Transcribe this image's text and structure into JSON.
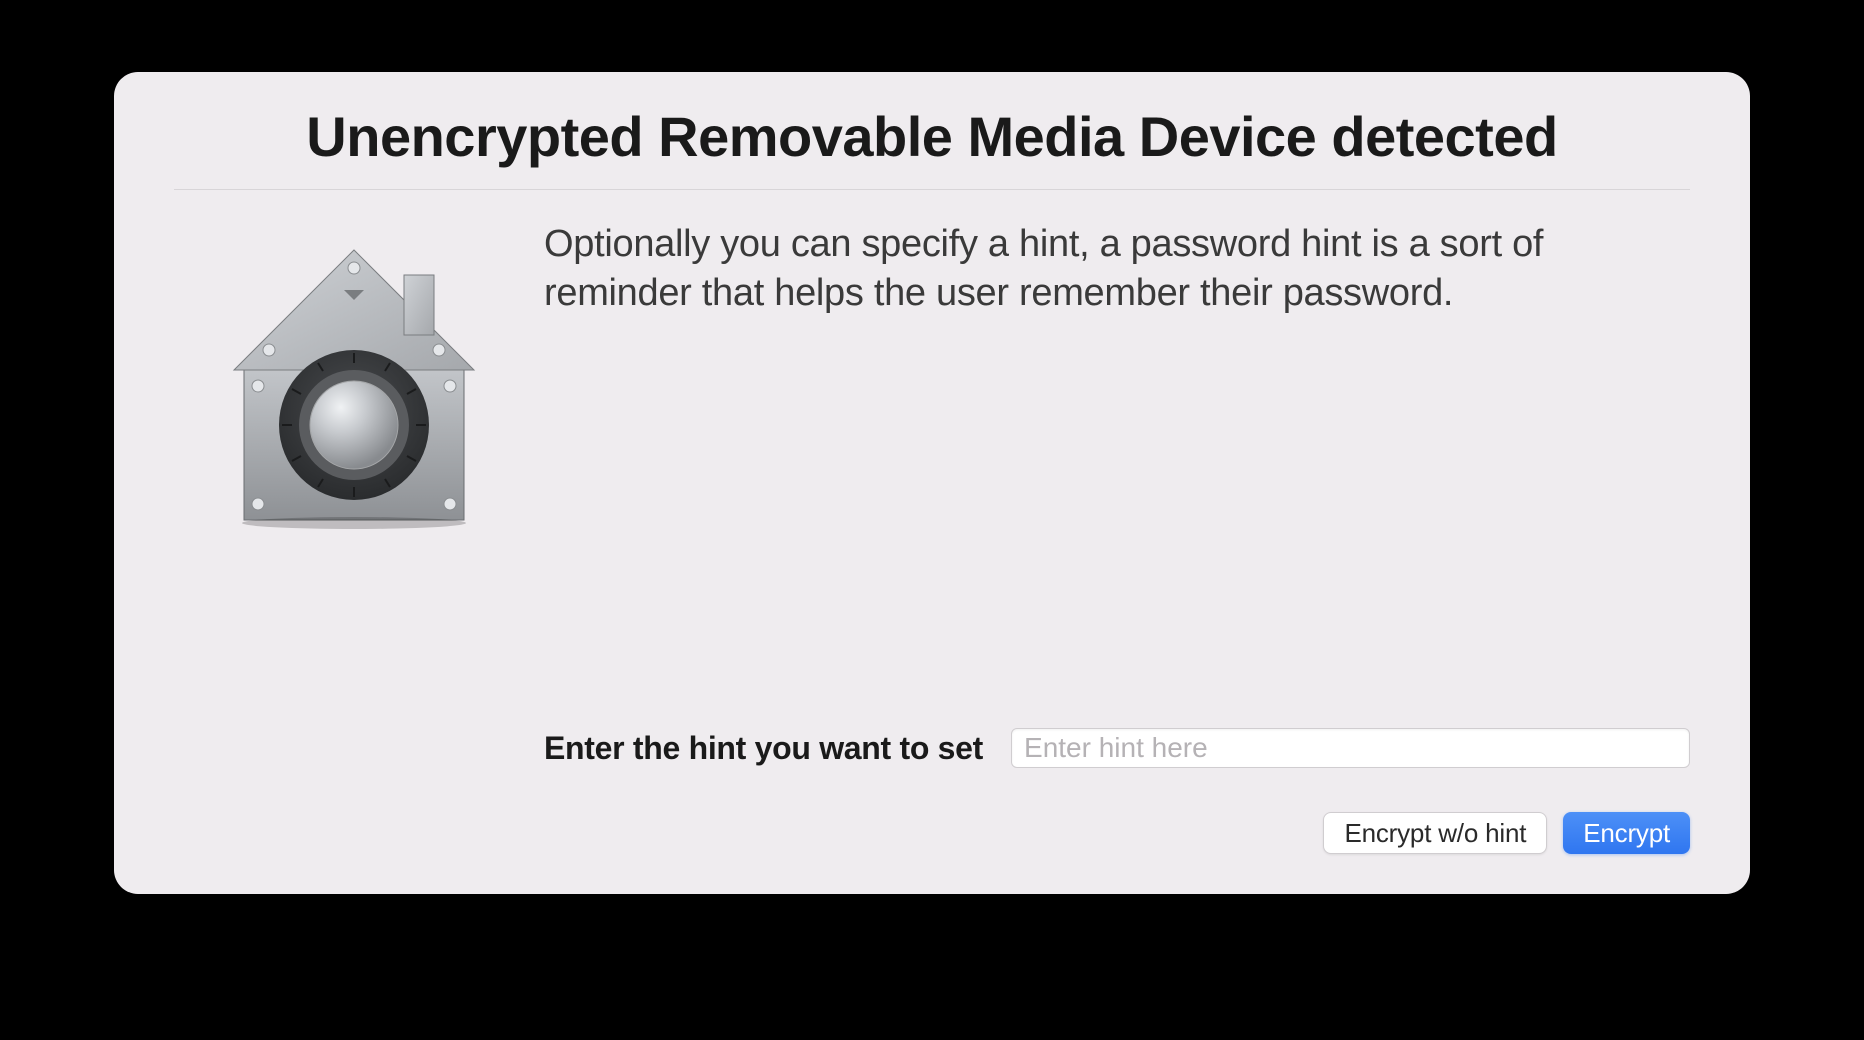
{
  "dialog": {
    "title": "Unencrypted Removable Media Device detected",
    "description": "Optionally you can specify a hint, a password hint is a sort of reminder that helps the user remember their password.",
    "icon_name": "vault-house-lock-icon"
  },
  "input": {
    "label": "Enter the hint you want to set",
    "placeholder": "Enter hint here",
    "value": ""
  },
  "buttons": {
    "secondary_label": "Encrypt w/o hint",
    "primary_label": "Encrypt"
  },
  "colors": {
    "dialog_bg": "#efecef",
    "primary_button": "#3b82f6",
    "text": "#1a1a1a",
    "description": "#3a3a3a",
    "placeholder": "#b5b2b5"
  }
}
